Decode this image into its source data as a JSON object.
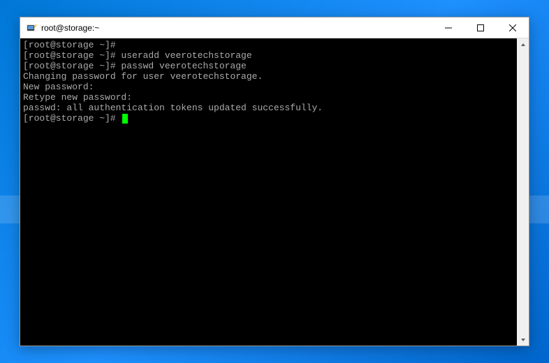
{
  "window": {
    "title": "root@storage:~"
  },
  "terminal": {
    "lines": [
      {
        "prompt": "[root@storage ~]#",
        "cmd": ""
      },
      {
        "prompt": "[root@storage ~]#",
        "cmd": " useradd veerotechstorage"
      },
      {
        "prompt": "[root@storage ~]#",
        "cmd": " passwd veerotechstorage"
      },
      {
        "text": "Changing password for user veerotechstorage."
      },
      {
        "text": "New password:"
      },
      {
        "text": "Retype new password:"
      },
      {
        "text": "passwd: all authentication tokens updated successfully."
      },
      {
        "prompt": "[root@storage ~]#",
        "cmd": " ",
        "cursor": true
      }
    ]
  }
}
